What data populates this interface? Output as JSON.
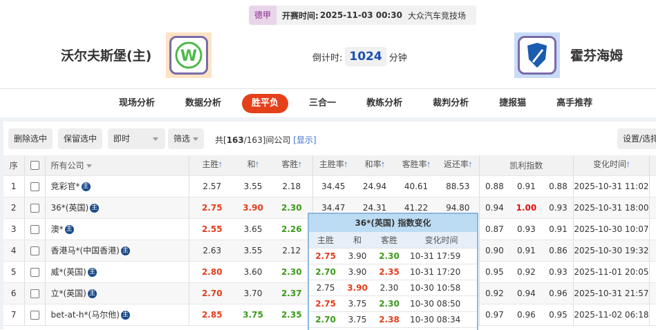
{
  "match": {
    "league": "德甲",
    "kickoff_label": "开赛时间:",
    "kickoff": "2025-11-03 00:30",
    "venue": "大众汽车竞技场",
    "home": "沃尔夫斯堡(主)",
    "away": "霍芬海姆",
    "countdown_label": "倒计时:",
    "countdown": "1024",
    "countdown_unit": "分钟"
  },
  "nav": [
    "现场分析",
    "数据分析",
    "胜平负",
    "三合一",
    "教练分析",
    "裁判分析",
    "捷报猫",
    "高手推荐"
  ],
  "toolbar": {
    "delete": "删除选中",
    "keep": "保留选中",
    "mode": "即时",
    "filter": "筛选",
    "count_prefix": "共[",
    "count_shown": "163",
    "count_total": "/163]间公司",
    "show": "[显示]",
    "settings": "设置/选择"
  },
  "headers": {
    "idx": "序",
    "company": "所有公司",
    "home": "主胜",
    "draw": "和",
    "away": "客胜",
    "home_rate": "主胜率",
    "draw_rate": "和率",
    "away_rate": "客胜率",
    "return": "返还率",
    "kelly": "凯利指数",
    "time": "变化时间"
  },
  "badge": "主",
  "colors": {
    "up": "#e33b1a",
    "down": "#3a9a1a",
    "accent": "#e4401a"
  },
  "rows": [
    {
      "i": "1",
      "name": "竞彩官*",
      "h": "2.57",
      "d": "3.55",
      "a": "2.18",
      "hc": "",
      "dc": "",
      "ac": "",
      "hr": "34.45",
      "dr": "24.94",
      "ar": "40.61",
      "ret": "88.53",
      "k1": "0.88",
      "k2": "0.91",
      "k3": "0.88",
      "t": "2025-10-31 11:02"
    },
    {
      "i": "2",
      "name": "36*(英国)",
      "h": "2.75",
      "d": "3.90",
      "a": "2.30",
      "hc": "r",
      "dc": "r",
      "ac": "g",
      "hr": "34.47",
      "dr": "24.31",
      "ar": "41.22",
      "ret": "94.80",
      "k1": "0.94",
      "k2": "1.00",
      "k3": "0.93",
      "k2c": "rr",
      "t": "2025-10-31 18:00"
    },
    {
      "i": "3",
      "name": "澳*",
      "h": "2.55",
      "d": "3.65",
      "a": "2.26",
      "hc": "r",
      "dc": "",
      "ac": "g",
      "hr": "",
      "dr": "",
      "ar": "",
      "ret": "",
      "k1": "0.87",
      "k2": "0.93",
      "k3": "0.91",
      "t": "2025-10-30 10:07"
    },
    {
      "i": "4",
      "name": "香港马*(中国香港)",
      "h": "2.63",
      "d": "3.55",
      "a": "2.12",
      "hc": "",
      "dc": "",
      "ac": "",
      "hr": "",
      "dr": "",
      "ar": "",
      "ret": "",
      "k1": "0.90",
      "k2": "0.91",
      "k3": "0.86",
      "t": "2025-10-30 19:32"
    },
    {
      "i": "5",
      "name": "威*(英国)",
      "h": "2.80",
      "d": "3.60",
      "a": "2.30",
      "hc": "r",
      "dc": "",
      "ac": "g",
      "hr": "",
      "dr": "",
      "ar": "",
      "ret": "",
      "k1": "0.95",
      "k2": "0.92",
      "k3": "0.93",
      "t": "2025-11-01 20:05"
    },
    {
      "i": "6",
      "name": "立*(英国)",
      "h": "2.70",
      "d": "3.70",
      "a": "2.37",
      "hc": "r",
      "dc": "",
      "ac": "g",
      "hr": "",
      "dr": "",
      "ar": "",
      "ret": "",
      "k1": "0.92",
      "k2": "0.94",
      "k3": "0.96",
      "t": "2025-10-31 21:57"
    },
    {
      "i": "7",
      "name": "bet-at-h*(马尔他)",
      "h": "2.85",
      "d": "3.75",
      "a": "2.35",
      "hc": "r",
      "dc": "g",
      "ac": "g",
      "hr": "",
      "dr": "",
      "ar": "",
      "ret": "",
      "k1": "0.97",
      "k2": "0.96",
      "k3": "0.95",
      "t": "2025-11-02 06:18"
    }
  ],
  "popup": {
    "title": "36*(英国) 指数变化",
    "headers": [
      "主胜",
      "和",
      "客胜",
      "变化时间"
    ],
    "rows": [
      {
        "h": "2.75",
        "d": "3.90",
        "a": "2.30",
        "hc": "r",
        "dc": "",
        "ac": "g",
        "t": "10-31 17:59"
      },
      {
        "h": "2.70",
        "d": "3.90",
        "a": "2.35",
        "hc": "g",
        "dc": "",
        "ac": "r",
        "t": "10-31 17:20"
      },
      {
        "h": "2.75",
        "d": "3.90",
        "a": "2.30",
        "hc": "",
        "dc": "r",
        "ac": "",
        "t": "10-30 10:58"
      },
      {
        "h": "2.75",
        "d": "3.75",
        "a": "2.30",
        "hc": "r",
        "dc": "",
        "ac": "g",
        "t": "10-30 08:50"
      },
      {
        "h": "2.70",
        "d": "3.75",
        "a": "2.38",
        "hc": "g",
        "dc": "",
        "ac": "r",
        "t": "10-30 08:34"
      }
    ]
  }
}
